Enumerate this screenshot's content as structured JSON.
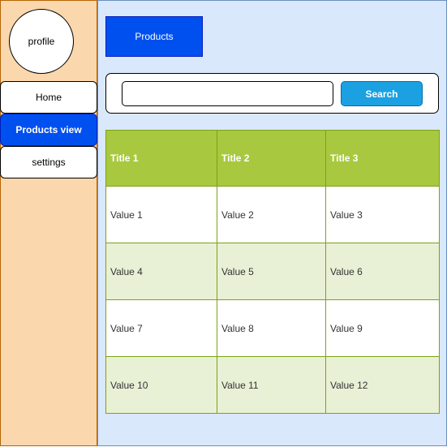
{
  "colors": {
    "sidebar_bg": "#fad7ac",
    "main_bg": "#dae8fc",
    "accent_blue": "#0050ef",
    "search_button": "#1ba1e2",
    "table_header": "#a8c93f",
    "table_alt_row": "#e8f0d6"
  },
  "sidebar": {
    "avatar_label": "profile",
    "items": [
      {
        "label": "Home",
        "active": false
      },
      {
        "label": "Products view",
        "active": true
      },
      {
        "label": "settings",
        "active": false
      }
    ]
  },
  "header": {
    "page_button_label": "Products"
  },
  "search": {
    "value": "",
    "button_label": "Search"
  },
  "table": {
    "columns": [
      "Title 1",
      "Title 2",
      "Title 3"
    ],
    "rows": [
      [
        "Value 1",
        "Value 2",
        "Value 3"
      ],
      [
        "Value 4",
        "Value 5",
        "Value 6"
      ],
      [
        "Value 7",
        "Value 8",
        "Value 9"
      ],
      [
        "Value 10",
        "Value 11",
        "Value 12"
      ]
    ]
  }
}
